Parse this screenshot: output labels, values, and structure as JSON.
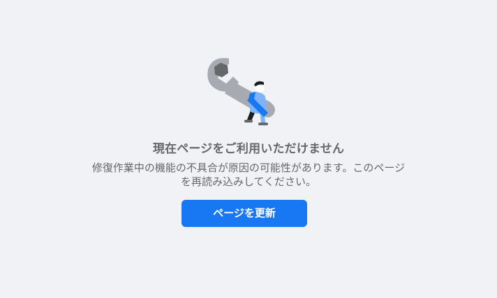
{
  "error": {
    "illustration_icon": "wrench-carrying-person-icon",
    "title": "現在ページをご利用いただけません",
    "message": "修復作業中の機能の不具合が原因の可能性があります。このページを再読み込みしてください。",
    "reload_button_label": "ページを更新"
  },
  "colors": {
    "background": "#f0f2f5",
    "text_secondary": "#65676b",
    "primary_button": "#1877f2",
    "wrench": "#a7aab0",
    "figure_blue": "#1877f2",
    "figure_light_blue": "#7fb3f7"
  }
}
